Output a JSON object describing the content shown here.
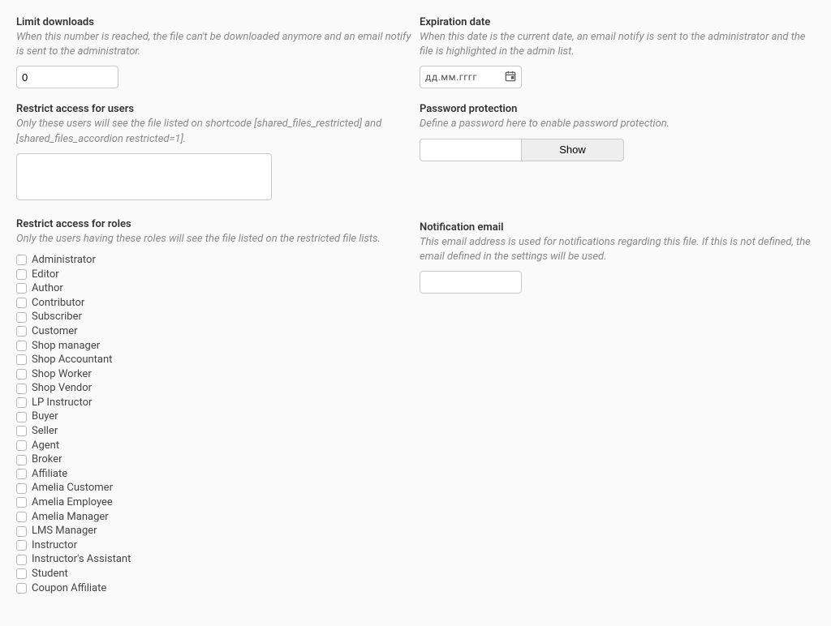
{
  "left": {
    "limit": {
      "label": "Limit downloads",
      "desc": "When this number is reached, the file can't be downloaded anymore and an email notify is sent to the administrator.",
      "value": "0"
    },
    "restrict_users": {
      "label": "Restrict access for users",
      "desc": "Only these users will see the file listed on shortcode [shared_files_restricted] and [shared_files_accordion restricted=1].",
      "value": ""
    },
    "restrict_roles": {
      "label": "Restrict access for roles",
      "desc": "Only the users having these roles will see the file listed on the restricted file lists.",
      "roles": [
        "Administrator",
        "Editor",
        "Author",
        "Contributor",
        "Subscriber",
        "Customer",
        "Shop manager",
        "Shop Accountant",
        "Shop Worker",
        "Shop Vendor",
        "LP Instructor",
        "Buyer",
        "Seller",
        "Agent",
        "Broker",
        "Affiliate",
        "Amelia Customer",
        "Amelia Employee",
        "Amelia Manager",
        "LMS Manager",
        "Instructor",
        "Instructor's Assistant",
        "Student",
        "Coupon Affiliate"
      ]
    }
  },
  "right": {
    "expiration": {
      "label": "Expiration date",
      "desc": "When this date is the current date, an email notify is sent to the administrator and the file is highlighted in the admin list.",
      "placeholder": "дд.мм.гггг"
    },
    "password": {
      "label": "Password protection",
      "desc": "Define a password here to enable password protection.",
      "value": "",
      "show_label": "Show"
    },
    "notification": {
      "label": "Notification email",
      "desc": "This email address is used for notifications regarding this file. If this is not defined, the email defined in the settings will be used.",
      "value": ""
    }
  }
}
